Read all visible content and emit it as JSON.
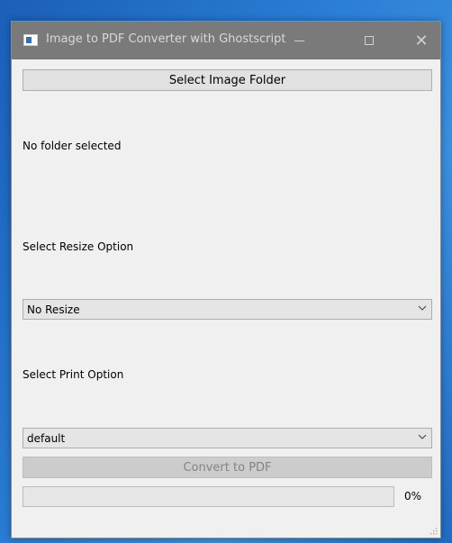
{
  "window": {
    "title": "Image to PDF Converter with Ghostscript"
  },
  "titlebar_controls": [
    "minimize",
    "maximize",
    "close"
  ],
  "select_folder_button": "Select Image Folder",
  "folder_status": "No folder selected",
  "resize": {
    "label": "Select Resize Option",
    "selected": "No Resize"
  },
  "print": {
    "label": "Select Print Option",
    "selected": "default"
  },
  "convert_button": {
    "label": "Convert to PDF",
    "enabled": false
  },
  "progress": {
    "value": 0,
    "text": "0%"
  },
  "colors": {
    "titlebar": "#7a7a7a",
    "window_bg": "#f0f0f0",
    "desktop": "#2a7fd6"
  },
  "icons": {
    "app": "app-window-icon",
    "minimize": "minimize-icon",
    "maximize": "maximize-icon",
    "close": "close-icon",
    "dropdown": "chevron-down-icon"
  }
}
